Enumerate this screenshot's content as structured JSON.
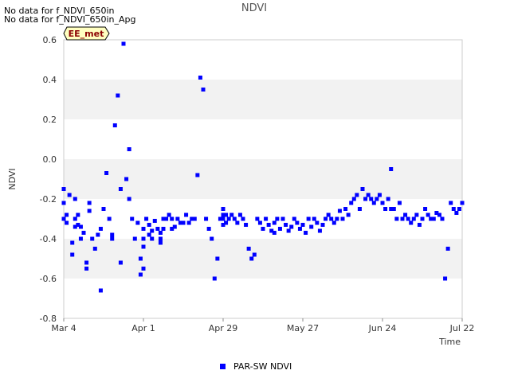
{
  "notes": [
    "No data for f_NDVI_650in",
    "No data for f_NDVI_650in_Apg"
  ],
  "badge": "EE_met",
  "colors": {
    "series": "#0000ff",
    "band": "#f2f2f2",
    "badge_bg": "#ffffc0"
  },
  "chart_data": {
    "type": "scatter",
    "title": "NDVI",
    "xlabel": "Time",
    "ylabel": "NDVI",
    "x_ticks": [
      "Mar 4",
      "Apr 1",
      "Apr 29",
      "May 27",
      "Jun 24",
      "Jul 22"
    ],
    "xlim": [
      "Mar 4",
      "Jul 22"
    ],
    "ylim": [
      -0.8,
      0.6
    ],
    "y_ticks": [
      "0.6",
      "0.4",
      "0.2",
      "0.0",
      "-0.2",
      "-0.4",
      "-0.6",
      "-0.8"
    ],
    "grid": "alternating horizontal bands",
    "legend_position": "bottom-center",
    "series": [
      {
        "name": "PAR-SW NDVI",
        "color": "#0000ff",
        "x_day": [
          0,
          0,
          0,
          1,
          1,
          2,
          3,
          3,
          4,
          4,
          4,
          5,
          5,
          6,
          6,
          7,
          8,
          8,
          9,
          9,
          10,
          11,
          12,
          13,
          13,
          14,
          15,
          16,
          17,
          17,
          18,
          19,
          20,
          20,
          21,
          22,
          23,
          23,
          24,
          25,
          26,
          27,
          27,
          28,
          28,
          28,
          28,
          29,
          30,
          30,
          31,
          31,
          32,
          33,
          34,
          34,
          34,
          35,
          35,
          36,
          37,
          38,
          38,
          39,
          40,
          41,
          42,
          43,
          44,
          45,
          46,
          47,
          48,
          49,
          50,
          51,
          52,
          53,
          54,
          55,
          56,
          56,
          56,
          56,
          57,
          57,
          58,
          59,
          60,
          61,
          62,
          63,
          64,
          65,
          66,
          67,
          68,
          69,
          70,
          71,
          72,
          73,
          74,
          74,
          75,
          76,
          77,
          78,
          79,
          80,
          81,
          82,
          83,
          84,
          85,
          86,
          87,
          88,
          89,
          90,
          91,
          92,
          93,
          94,
          95,
          96,
          97,
          98,
          99,
          100,
          101,
          102,
          103,
          104,
          105,
          106,
          107,
          108,
          109,
          110,
          111,
          112,
          113,
          114,
          115,
          115,
          116,
          117,
          118,
          119,
          120,
          121,
          122,
          123,
          124,
          125,
          126,
          127,
          128,
          129,
          130,
          131,
          132,
          133,
          134,
          135,
          136,
          137,
          138,
          139,
          140
        ],
        "y": [
          -0.15,
          -0.22,
          -0.3,
          -0.28,
          -0.32,
          -0.18,
          -0.42,
          -0.48,
          -0.3,
          -0.2,
          -0.34,
          -0.28,
          -0.33,
          -0.4,
          -0.34,
          -0.37,
          -0.52,
          -0.55,
          -0.26,
          -0.22,
          -0.4,
          -0.45,
          -0.38,
          -0.35,
          -0.66,
          -0.25,
          -0.07,
          -0.3,
          -0.38,
          -0.4,
          0.17,
          0.32,
          -0.15,
          -0.52,
          0.58,
          -0.1,
          -0.2,
          0.05,
          -0.3,
          -0.4,
          -0.32,
          -0.5,
          -0.58,
          -0.35,
          -0.4,
          -0.44,
          -0.55,
          -0.3,
          -0.33,
          -0.38,
          -0.4,
          -0.36,
          -0.31,
          -0.35,
          -0.4,
          -0.37,
          -0.42,
          -0.3,
          -0.35,
          -0.3,
          -0.28,
          -0.3,
          -0.35,
          -0.34,
          -0.3,
          -0.32,
          -0.32,
          -0.28,
          -0.32,
          -0.3,
          -0.3,
          -0.08,
          0.41,
          0.35,
          -0.3,
          -0.35,
          -0.4,
          -0.6,
          -0.5,
          -0.3,
          -0.28,
          -0.25,
          -0.3,
          -0.33,
          -0.28,
          -0.32,
          -0.3,
          -0.28,
          -0.3,
          -0.32,
          -0.28,
          -0.3,
          -0.33,
          -0.45,
          -0.5,
          -0.48,
          -0.3,
          -0.32,
          -0.35,
          -0.3,
          -0.33,
          -0.36,
          -0.37,
          -0.32,
          -0.3,
          -0.35,
          -0.3,
          -0.33,
          -0.36,
          -0.34,
          -0.3,
          -0.32,
          -0.35,
          -0.33,
          -0.37,
          -0.3,
          -0.34,
          -0.3,
          -0.32,
          -0.36,
          -0.33,
          -0.3,
          -0.28,
          -0.3,
          -0.32,
          -0.3,
          -0.26,
          -0.3,
          -0.25,
          -0.28,
          -0.22,
          -0.2,
          -0.18,
          -0.25,
          -0.15,
          -0.2,
          -0.18,
          -0.2,
          -0.22,
          -0.2,
          -0.18,
          -0.22,
          -0.25,
          -0.2,
          -0.05,
          -0.25,
          -0.25,
          -0.3,
          -0.22,
          -0.3,
          -0.28,
          -0.3,
          -0.32,
          -0.3,
          -0.28,
          -0.33,
          -0.3,
          -0.25,
          -0.28,
          -0.3,
          -0.3,
          -0.27,
          -0.28,
          -0.3,
          -0.6,
          -0.45,
          -0.22,
          -0.25,
          -0.27,
          -0.25,
          -0.22,
          -0.25,
          -0.25
        ]
      }
    ]
  }
}
